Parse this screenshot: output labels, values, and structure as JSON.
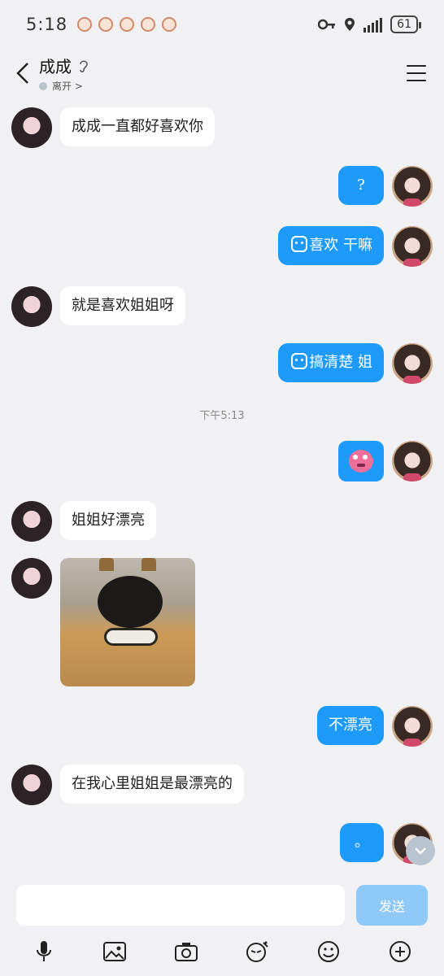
{
  "status": {
    "time": "5:18",
    "battery": "61"
  },
  "header": {
    "contact_name": "成成",
    "status_text": "离开 >"
  },
  "messages": [
    {
      "side": "left",
      "type": "text",
      "text": "成成一直都好喜欢你"
    },
    {
      "side": "right",
      "type": "text",
      "text": "?"
    },
    {
      "side": "right",
      "type": "text",
      "text": "喜欢 干嘛"
    },
    {
      "side": "left",
      "type": "text",
      "text": "就是喜欢姐姐呀"
    },
    {
      "side": "right",
      "type": "text",
      "text": "搞清楚 姐"
    },
    {
      "side": "right",
      "type": "sticker",
      "text": ""
    },
    {
      "side": "left",
      "type": "text",
      "text": "姐姐好漂亮"
    },
    {
      "side": "left",
      "type": "image",
      "text": ""
    },
    {
      "side": "right",
      "type": "text",
      "text": "不漂亮"
    },
    {
      "side": "left",
      "type": "text",
      "text": "在我心里姐姐是最漂亮的"
    },
    {
      "side": "right",
      "type": "text",
      "text": "。"
    }
  ],
  "timestamp": "下午5:13",
  "input": {
    "placeholder": "",
    "send_label": "发送"
  },
  "toolbar": [
    "mic-icon",
    "image-icon",
    "camera-icon",
    "sticker-pen-icon",
    "emoji-icon",
    "plus-icon"
  ],
  "colors": {
    "bubble_mine": "#1e9bfa",
    "background": "#f1f1f3"
  }
}
